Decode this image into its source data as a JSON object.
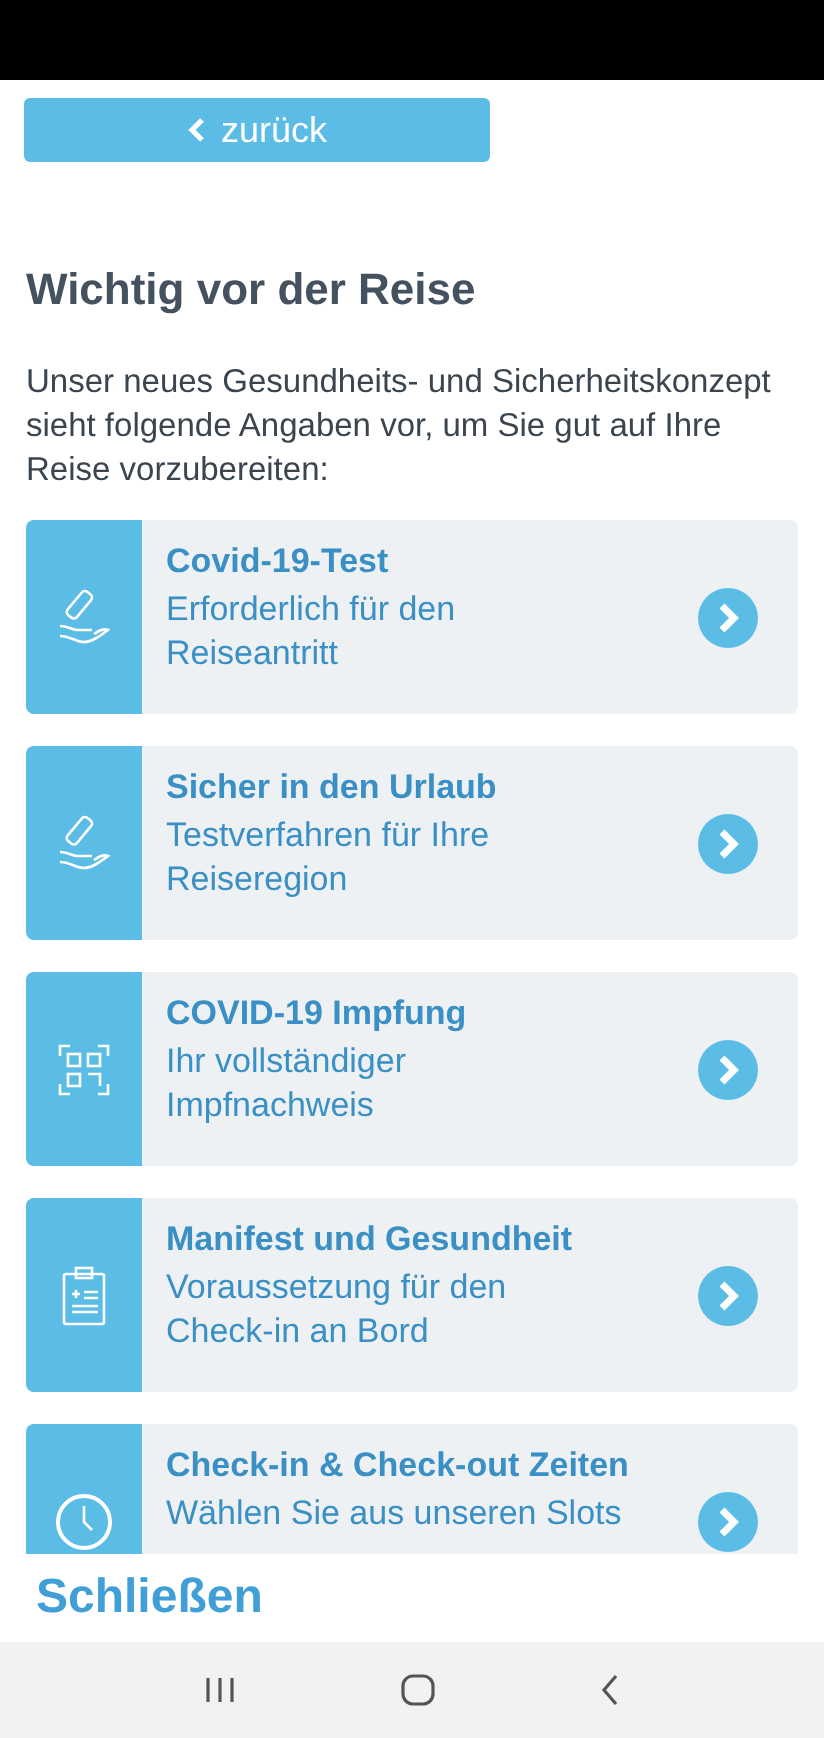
{
  "back_button": {
    "label": "zurück"
  },
  "heading": "Wichtig vor der Reise",
  "intro": "Unser neues Gesundheits- und Sicherheitskonzept sieht folgende Angaben vor, um Sie gut auf Ihre Reise vorzubereiten:",
  "cards": [
    {
      "kind": "test",
      "title": "Covid-19-Test",
      "subtitle": "Erforderlich für den Reiseantritt"
    },
    {
      "kind": "test",
      "title": "Sicher in den Urlaub",
      "subtitle": "Testverfahren für Ihre Reiseregion"
    },
    {
      "kind": "qr",
      "title": "COVID-19 Impfung",
      "subtitle": "Ihr vollständiger Impfnachweis"
    },
    {
      "kind": "clipboard",
      "title": "Manifest und Gesundheit",
      "subtitle": "Voraussetzung für den Check-in an Bord"
    },
    {
      "kind": "clock",
      "title": "Check-in & Check-out Zeiten",
      "subtitle": "Wählen Sie aus unseren Slots"
    }
  ],
  "close_button": {
    "label": "Schließen"
  }
}
